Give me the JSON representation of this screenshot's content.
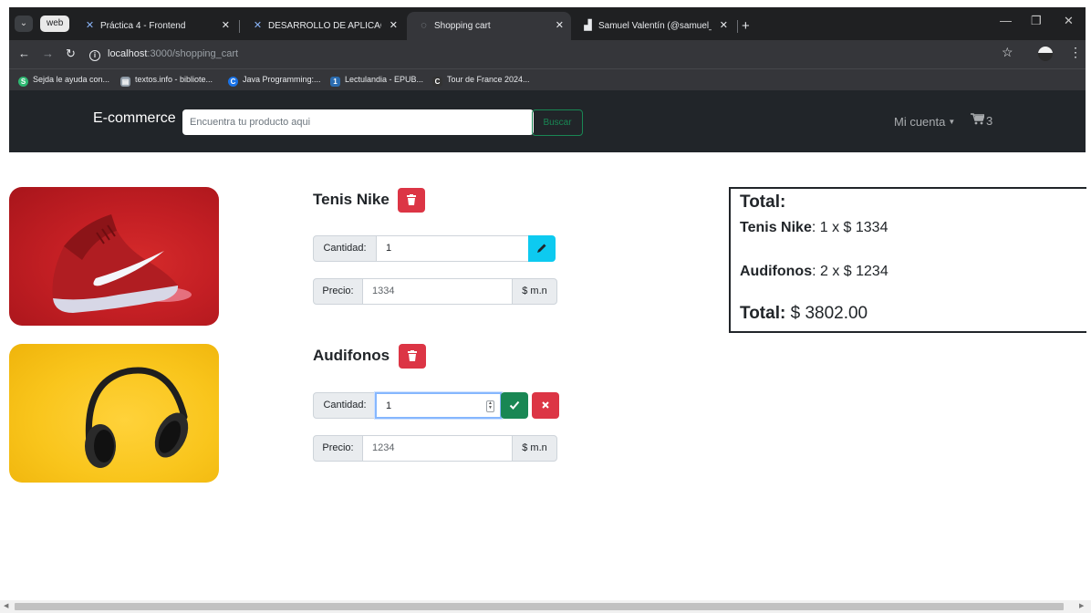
{
  "browser": {
    "group_chip": "web",
    "tabs": [
      {
        "title": "Práctica 4 - Frontend",
        "active": false
      },
      {
        "title": "DESARROLLO DE APLICACIONE",
        "active": false
      },
      {
        "title": "Shopping cart",
        "active": true
      },
      {
        "title": "Samuel Valentín (@samuel_vale",
        "active": false
      }
    ],
    "new_tab": "+",
    "url_host": "localhost",
    "url_path": ":3000/shopping_cart",
    "bookmarks": [
      {
        "label": "Sejda le ayuda con...",
        "icon_color": "#2eb872",
        "icon_char": "S"
      },
      {
        "label": "textos.info - bibliote...",
        "icon_color": "#8e9aa6",
        "icon_char": "▤"
      },
      {
        "label": "Java Programming:...",
        "icon_color": "#1a73e8",
        "icon_char": "C"
      },
      {
        "label": "Lectulandia - EPUB...",
        "icon_color": "#2b6cb0",
        "icon_char": "1"
      },
      {
        "label": "Tour de France 2024...",
        "icon_color": "#333333",
        "icon_char": "C"
      }
    ]
  },
  "navbar": {
    "brand": "E-commerce",
    "search_placeholder": "Encuentra tu producto aqui",
    "search_button": "Buscar",
    "account": "Mi cuenta",
    "cart_count": "3"
  },
  "products": [
    {
      "name": "Tenis Nike",
      "quantity_label": "Cantidad:",
      "quantity": "1",
      "price_label": "Precio:",
      "price": "1334",
      "currency": "$ m.n",
      "image": "red-nike-sneaker"
    },
    {
      "name": "Audifonos",
      "quantity_label": "Cantidad:",
      "quantity": "1",
      "price_label": "Precio:",
      "price": "1234",
      "currency": "$ m.n",
      "image": "black-headphones"
    }
  ],
  "totals": {
    "heading": "Total:",
    "lines": [
      {
        "name": "Tenis Nike",
        "detail": "1 x $ 1334"
      },
      {
        "name": "Audifonos",
        "detail": "2 x $ 1234"
      }
    ],
    "grand_label": "Total:",
    "grand_value": "$ 3802.00"
  },
  "colors": {
    "navbar_bg": "#212529",
    "danger": "#dc3545",
    "info": "#0dcaf0",
    "success": "#198754"
  }
}
